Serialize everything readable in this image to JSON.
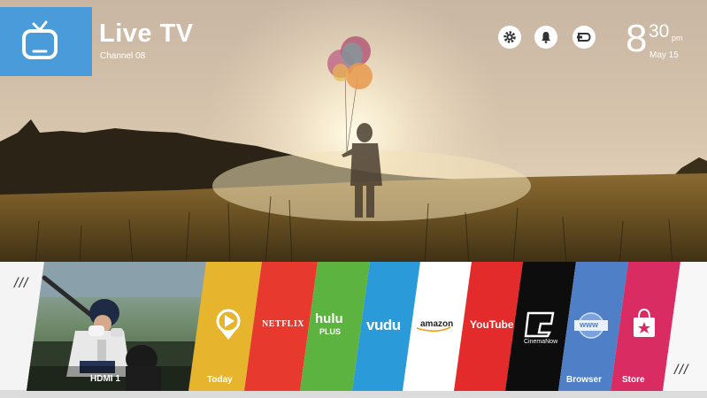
{
  "channel": {
    "title": "Live TV",
    "subtitle": "Channel 08",
    "icon": "tv-icon"
  },
  "status_icons": [
    "gear-icon",
    "bell-icon",
    "input-source-icon"
  ],
  "clock": {
    "hour": "8",
    "minutes": "30",
    "ampm": "pm",
    "date": "May 15"
  },
  "launcher": {
    "menu_left": "///",
    "menu_right": "///",
    "input": {
      "label": "HDMI 1"
    },
    "apps": [
      {
        "id": "today",
        "label": "Today",
        "logo": "",
        "color": "#e6b52d"
      },
      {
        "id": "netflix",
        "label": "",
        "logo": "NETFLIX",
        "color": "#e8392f"
      },
      {
        "id": "hulu",
        "label": "",
        "logo": "hulu",
        "logo2": "PLUS",
        "color": "#5db33f"
      },
      {
        "id": "vudu",
        "label": "",
        "logo": "vudu",
        "color": "#2a9ad8"
      },
      {
        "id": "amazon",
        "label": "",
        "logo": "amazon",
        "color": "#ffffff"
      },
      {
        "id": "youtube",
        "label": "",
        "logo": "YouTube",
        "color": "#e32b2b"
      },
      {
        "id": "cinemanow",
        "label": "",
        "logo": "CinemaNow",
        "color": "#0d0d0d"
      },
      {
        "id": "browser",
        "label": "Browser",
        "logo": "www",
        "color": "#4f7fc6"
      },
      {
        "id": "store",
        "label": "Store",
        "logo": "",
        "color": "#d92c63"
      }
    ]
  }
}
